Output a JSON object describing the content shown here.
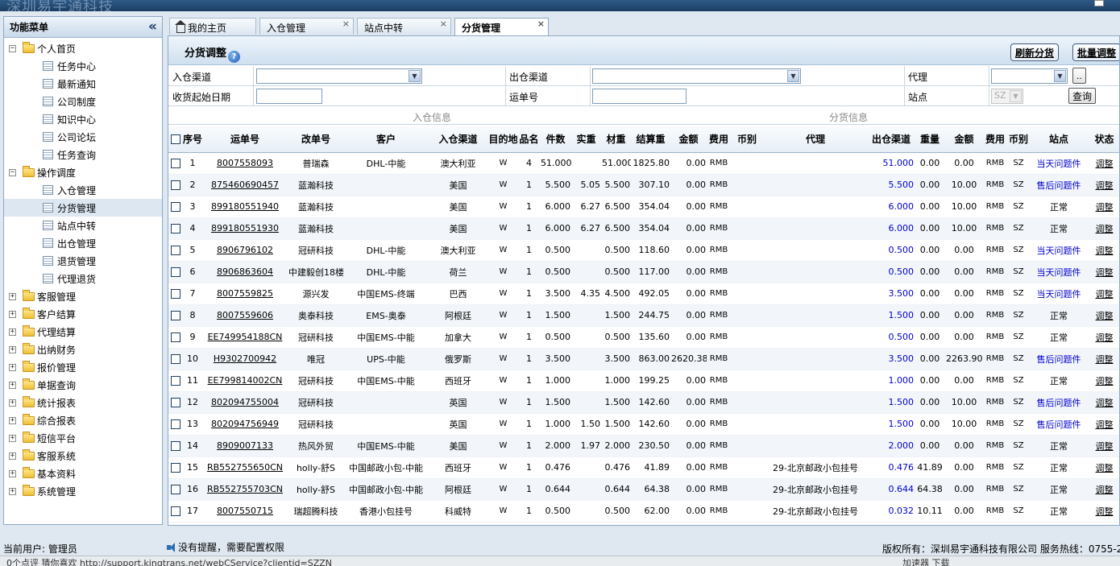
{
  "window": {
    "logo_text": "深圳易宇通科技"
  },
  "sidebar": {
    "title": "功能菜单",
    "groups": [
      {
        "label": "个人首页",
        "expanded": true,
        "items": [
          "任务中心",
          "最新通知",
          "公司制度",
          "知识中心",
          "公司论坛",
          "任务查询"
        ]
      },
      {
        "label": "操作调度",
        "expanded": true,
        "items": [
          "入仓管理",
          "分货管理",
          "站点中转",
          "出仓管理",
          "退货管理",
          "代理退货"
        ]
      },
      {
        "label": "客服管理"
      },
      {
        "label": "客户结算"
      },
      {
        "label": "代理结算"
      },
      {
        "label": "出纳财务"
      },
      {
        "label": "报价管理"
      },
      {
        "label": "单据查询"
      },
      {
        "label": "统计报表"
      },
      {
        "label": "综合报表"
      },
      {
        "label": "短信平台"
      },
      {
        "label": "客服系统"
      },
      {
        "label": "基本资料"
      },
      {
        "label": "系统管理"
      }
    ],
    "selected": "分货管理"
  },
  "tabs": [
    {
      "label": "我的主页",
      "closable": false
    },
    {
      "label": "入仓管理",
      "closable": true
    },
    {
      "label": "站点中转",
      "closable": true
    },
    {
      "label": "分货管理",
      "closable": true,
      "active": true
    }
  ],
  "panel": {
    "title": "分货调整",
    "buttons": {
      "refresh": "刷新分货",
      "batch": "批量调整"
    }
  },
  "filters": {
    "inbound_channel_label": "入仓渠道",
    "outbound_channel_label": "出仓渠道",
    "agent_label": "代理",
    "agent_btn": "..",
    "date_label": "收货起始日期",
    "waybill_label": "运单号",
    "station_label": "站点",
    "station_value": "SZ",
    "query_btn": "查询",
    "group_inbound": "入仓信息",
    "group_sorting": "分货信息"
  },
  "table": {
    "headers": [
      "序号",
      "运单号",
      "改单号",
      "客户",
      "入仓渠道",
      "目的地",
      "品名",
      "件数",
      "实重",
      "材重",
      "结算重",
      "金额",
      "费用",
      "币别",
      "代理",
      "出仓渠道",
      "重量",
      "金额",
      "费用",
      "币别",
      "站点",
      "状态"
    ],
    "rows": [
      [
        "1",
        "8007558093",
        "普瑞森",
        "DHL-中能",
        "澳大利亚",
        "W",
        "4",
        "51.000",
        "",
        "51.000",
        "1825.80",
        "0.00",
        "RMB",
        "",
        "",
        "51.000",
        "0.00",
        "0.00",
        "RMB",
        "SZ",
        "当天问题件",
        "调整"
      ],
      [
        "2",
        "875460690457",
        "蓝瀚科技",
        "",
        "美国",
        "W",
        "1",
        "5.500",
        "5.05",
        "5.500",
        "307.10",
        "0.00",
        "RMB",
        "",
        "",
        "5.500",
        "0.00",
        "10.00",
        "RMB",
        "SZ",
        "售后问题件",
        "调整"
      ],
      [
        "3",
        "899180551940",
        "蓝瀚科技",
        "",
        "美国",
        "W",
        "1",
        "6.000",
        "6.27",
        "6.500",
        "354.04",
        "0.00",
        "RMB",
        "",
        "",
        "6.000",
        "0.00",
        "10.00",
        "RMB",
        "SZ",
        "正常",
        "调整"
      ],
      [
        "4",
        "899180551930",
        "蓝瀚科技",
        "",
        "美国",
        "W",
        "1",
        "6.000",
        "6.27",
        "6.500",
        "354.04",
        "0.00",
        "RMB",
        "",
        "",
        "6.000",
        "0.00",
        "10.00",
        "RMB",
        "SZ",
        "正常",
        "调整"
      ],
      [
        "5",
        "8906796102",
        "冠研科技",
        "DHL-中能",
        "澳大利亚",
        "W",
        "1",
        "0.500",
        "",
        "0.500",
        "118.60",
        "0.00",
        "RMB",
        "",
        "",
        "0.500",
        "0.00",
        "0.00",
        "RMB",
        "SZ",
        "当天问题件",
        "调整"
      ],
      [
        "6",
        "8906863604",
        "中建毅创18楼",
        "DHL-中能",
        "荷兰",
        "W",
        "1",
        "0.500",
        "",
        "0.500",
        "117.00",
        "0.00",
        "RMB",
        "",
        "",
        "0.500",
        "0.00",
        "0.00",
        "RMB",
        "SZ",
        "当天问题件",
        "调整"
      ],
      [
        "7",
        "8007559825",
        "源兴发",
        "中国EMS-终端",
        "巴西",
        "W",
        "1",
        "3.500",
        "4.35",
        "4.500",
        "492.05",
        "0.00",
        "RMB",
        "",
        "",
        "3.500",
        "0.00",
        "0.00",
        "RMB",
        "SZ",
        "当天问题件",
        "调整"
      ],
      [
        "8",
        "8007559606",
        "奥泰科技",
        "EMS-奥泰",
        "阿根廷",
        "W",
        "1",
        "1.500",
        "",
        "1.500",
        "244.75",
        "0.00",
        "RMB",
        "",
        "",
        "1.500",
        "0.00",
        "0.00",
        "RMB",
        "SZ",
        "正常",
        "调整"
      ],
      [
        "9",
        "EE749954188CN",
        "冠研科技",
        "中国EMS-中能",
        "加拿大",
        "W",
        "1",
        "0.500",
        "",
        "0.500",
        "135.60",
        "0.00",
        "RMB",
        "",
        "",
        "0.500",
        "0.00",
        "0.00",
        "RMB",
        "SZ",
        "正常",
        "调整"
      ],
      [
        "10",
        "H9302700942",
        "唯冠",
        "UPS-中能",
        "俄罗斯",
        "W",
        "1",
        "3.500",
        "",
        "3.500",
        "863.00",
        "2620.38",
        "RMB",
        "",
        "",
        "3.500",
        "0.00",
        "2263.90",
        "RMB",
        "SZ",
        "售后问题件",
        "调整"
      ],
      [
        "11",
        "EE799814002CN",
        "冠研科技",
        "中国EMS-中能",
        "西班牙",
        "W",
        "1",
        "1.000",
        "",
        "1.000",
        "199.25",
        "0.00",
        "RMB",
        "",
        "",
        "1.000",
        "0.00",
        "0.00",
        "RMB",
        "SZ",
        "正常",
        "调整"
      ],
      [
        "12",
        "802094755004",
        "冠研科技",
        "",
        "英国",
        "W",
        "1",
        "1.500",
        "",
        "1.500",
        "142.60",
        "0.00",
        "RMB",
        "",
        "",
        "1.500",
        "0.00",
        "10.00",
        "RMB",
        "SZ",
        "售后问题件",
        "调整"
      ],
      [
        "13",
        "802094756949",
        "冠研科技",
        "",
        "英国",
        "W",
        "1",
        "1.000",
        "1.50",
        "1.500",
        "142.60",
        "0.00",
        "RMB",
        "",
        "",
        "1.500",
        "0.00",
        "10.00",
        "RMB",
        "SZ",
        "售后问题件",
        "调整"
      ],
      [
        "14",
        "8909007133",
        "热风外贸",
        "中国EMS-中能",
        "美国",
        "W",
        "1",
        "2.000",
        "1.97",
        "2.000",
        "230.50",
        "0.00",
        "RMB",
        "",
        "",
        "2.000",
        "0.00",
        "0.00",
        "RMB",
        "SZ",
        "正常",
        "调整"
      ],
      [
        "15",
        "RB552755650CN",
        "holly-舒S",
        "中国邮政小包-中能",
        "西班牙",
        "W",
        "1",
        "0.476",
        "",
        "0.476",
        "41.89",
        "0.00",
        "RMB",
        "",
        "29-北京邮政小包挂号",
        "0.476",
        "41.89",
        "0.00",
        "RMB",
        "SZ",
        "正常",
        "调整"
      ],
      [
        "16",
        "RB552755703CN",
        "holly-舒S",
        "中国邮政小包-中能",
        "阿根廷",
        "W",
        "1",
        "0.644",
        "",
        "0.644",
        "64.38",
        "0.00",
        "RMB",
        "",
        "29-北京邮政小包挂号",
        "0.644",
        "64.38",
        "0.00",
        "RMB",
        "SZ",
        "正常",
        "调整"
      ],
      [
        "17",
        "8007550715",
        "瑞超腾科技",
        "香港小包挂号",
        "科威特",
        "W",
        "1",
        "0.500",
        "",
        "0.500",
        "62.00",
        "0.00",
        "RMB",
        "",
        "29-北京邮政小包挂号",
        "0.032",
        "10.11",
        "0.00",
        "RMB",
        "SZ",
        "正常",
        "调整"
      ]
    ]
  },
  "footer": {
    "current_user": "当前用户: 管理员",
    "notice": "没有提醒，需要配置权限",
    "copyright": "版权所有：深圳易宇通科技有限公司 服务热线：0755-2"
  },
  "statusbar": {
    "text": "0个点评    猜你喜欢    http://support.kingtrans.net/webCService?clientid=SZZN",
    "right": "加速器    下载"
  },
  "colors": {
    "blue_text": "#0000cc",
    "header_bg": "#cfe0ef",
    "border": "#8ea9c4"
  }
}
